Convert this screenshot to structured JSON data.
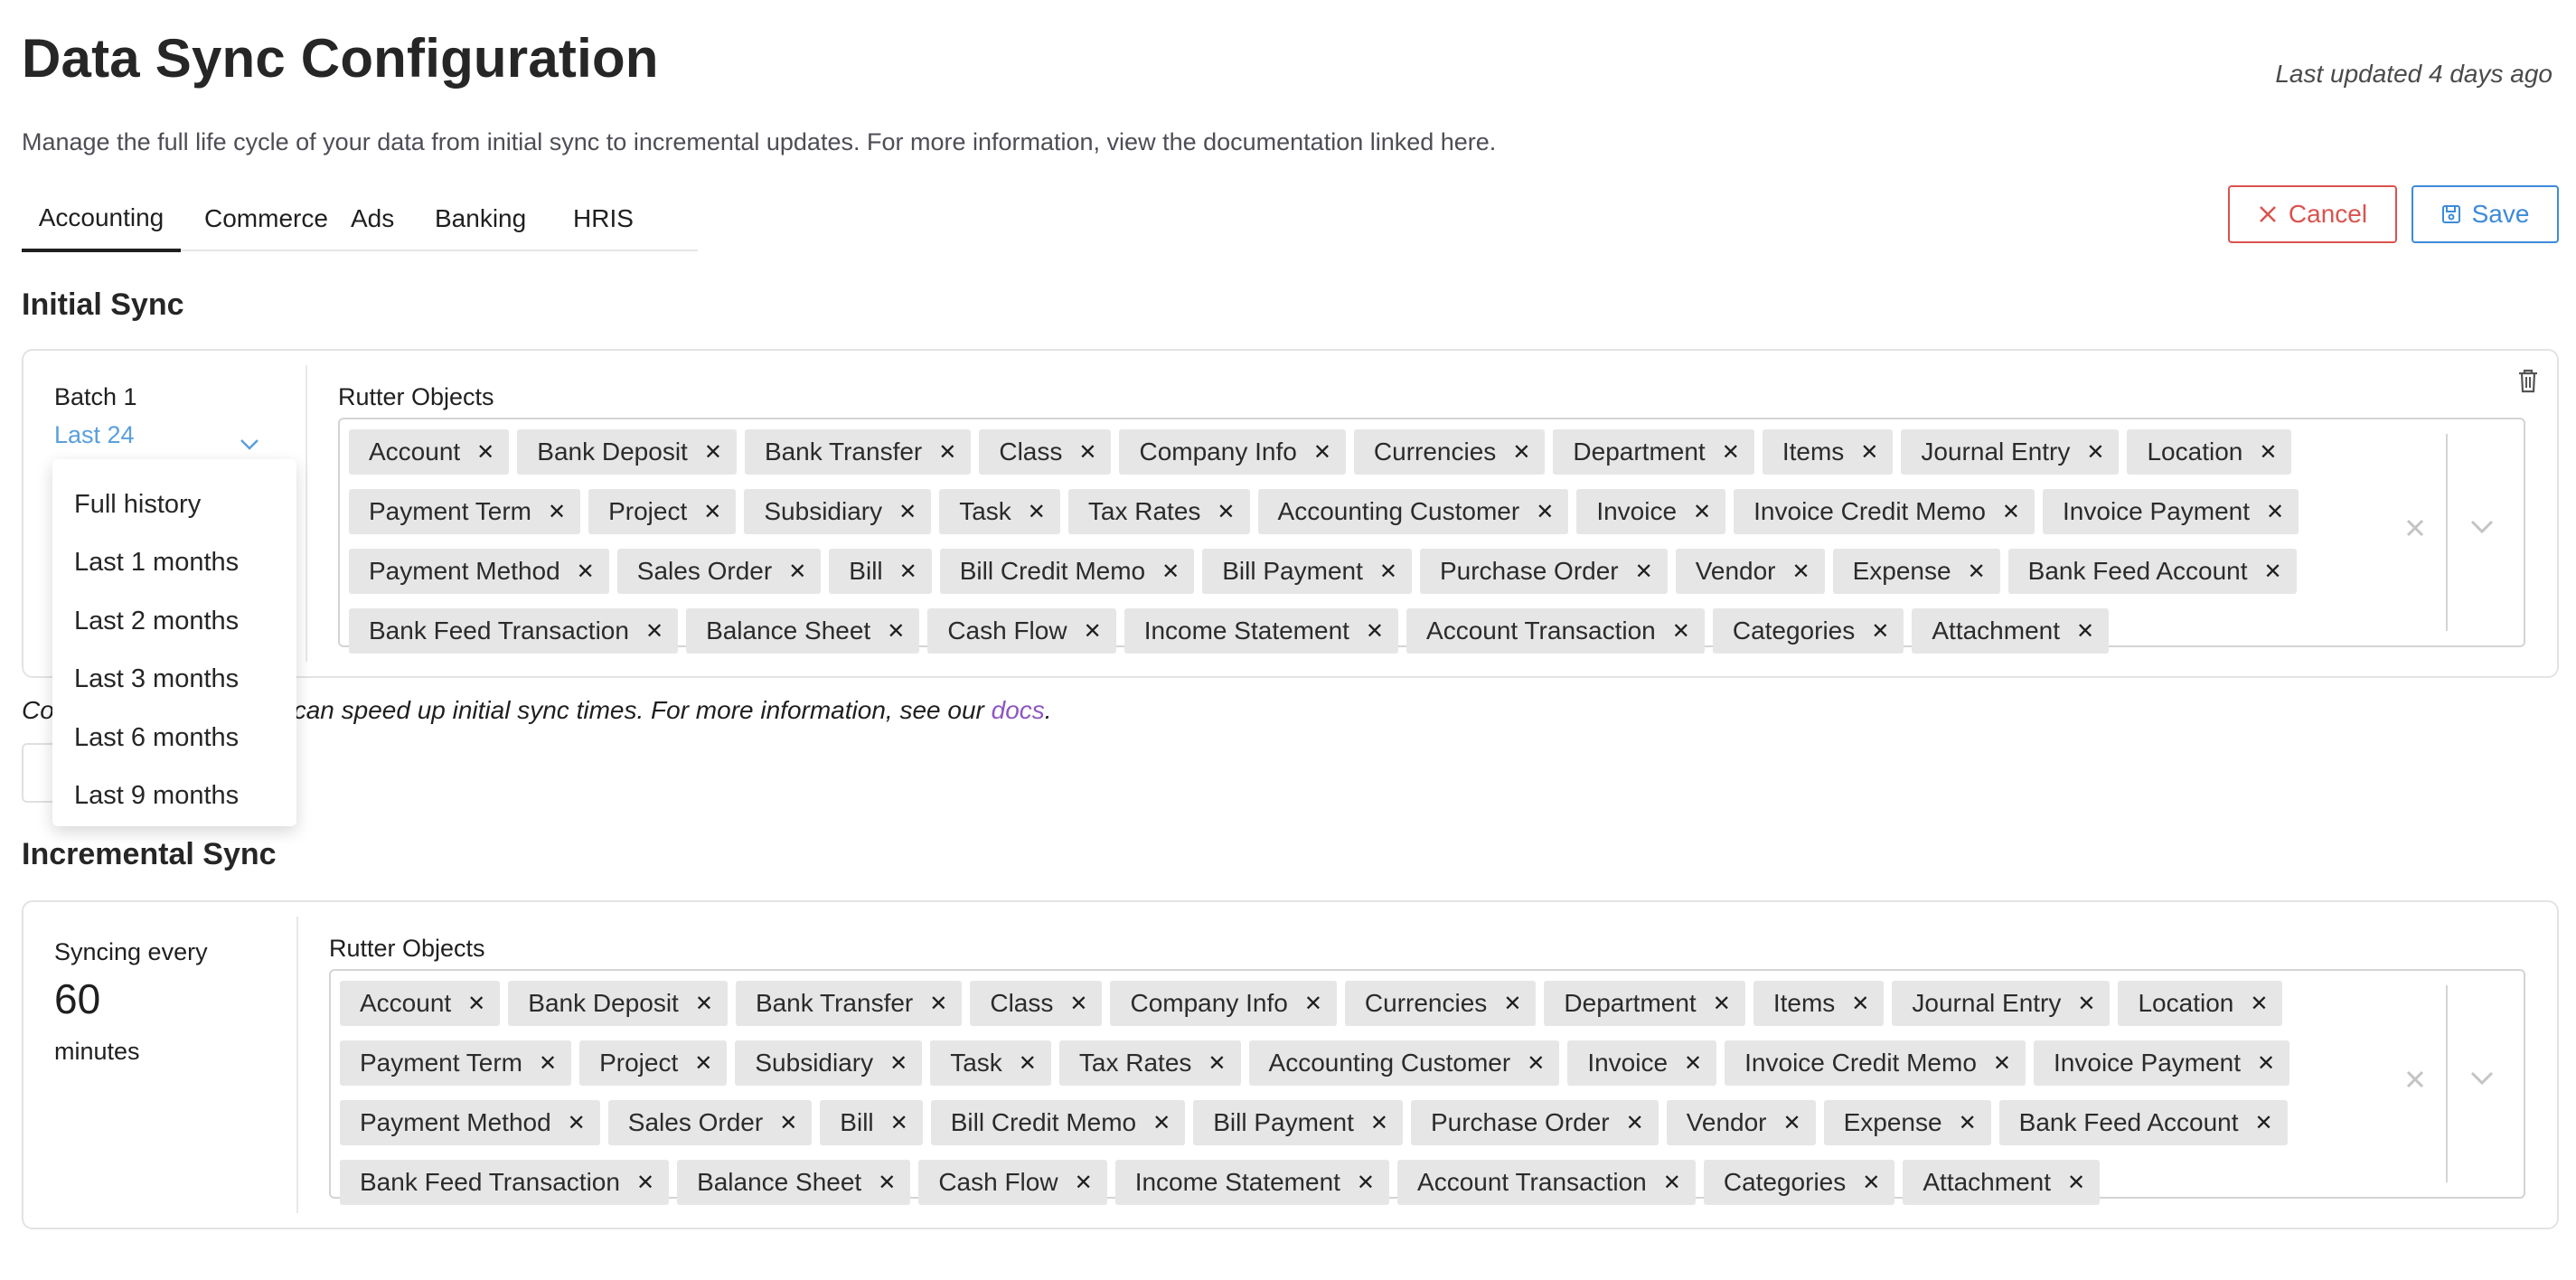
{
  "header": {
    "title": "Data Sync Configuration",
    "last_updated": "Last updated 4 days ago",
    "subtitle": "Manage the full life cycle of your data from initial sync to incremental updates. For more information, view the documentation linked here."
  },
  "tabs": [
    {
      "label": "Accounting",
      "active": true
    },
    {
      "label": "Commerce",
      "active": false
    },
    {
      "label": "Ads",
      "active": false
    },
    {
      "label": "Banking",
      "active": false
    },
    {
      "label": "HRIS",
      "active": false
    }
  ],
  "actions": {
    "cancel_label": "Cancel",
    "save_label": "Save"
  },
  "initial_sync": {
    "title": "Initial Sync",
    "batch_label": "Batch 1",
    "batch_selected": "Last 24",
    "rutter_objects_label": "Rutter Objects",
    "objects": [
      "Account",
      "Bank Deposit",
      "Bank Transfer",
      "Class",
      "Company Info",
      "Currencies",
      "Department",
      "Items",
      "Journal Entry",
      "Location",
      "Payment Term",
      "Project",
      "Subsidiary",
      "Task",
      "Tax Rates",
      "Accounting Customer",
      "Invoice",
      "Invoice Credit Memo",
      "Invoice Payment",
      "Payment Method",
      "Sales Order",
      "Bill",
      "Bill Credit Memo",
      "Bill Payment",
      "Purchase Order",
      "Vendor",
      "Expense",
      "Bank Feed Account",
      "Bank Feed Transaction",
      "Balance Sheet",
      "Cash Flow",
      "Income Statement",
      "Account Transaction",
      "Categories",
      "Attachment"
    ],
    "note_prefix": "Co",
    "note_text": "ches can speed up initial sync times. For more information, see our ",
    "note_link": "docs",
    "note_suffix": "."
  },
  "dropdown": {
    "options": [
      "Full history",
      "Last 1 months",
      "Last 2 months",
      "Last 3 months",
      "Last 6 months",
      "Last 9 months"
    ]
  },
  "incremental_sync": {
    "title": "Incremental Sync",
    "syncing_label": "Syncing every",
    "value": "60",
    "unit": "minutes",
    "rutter_objects_label": "Rutter Objects",
    "objects": [
      "Account",
      "Bank Deposit",
      "Bank Transfer",
      "Class",
      "Company Info",
      "Currencies",
      "Department",
      "Items",
      "Journal Entry",
      "Location",
      "Payment Term",
      "Project",
      "Subsidiary",
      "Task",
      "Tax Rates",
      "Accounting Customer",
      "Invoice",
      "Invoice Credit Memo",
      "Invoice Payment",
      "Payment Method",
      "Sales Order",
      "Bill",
      "Bill Credit Memo",
      "Bill Payment",
      "Purchase Order",
      "Vendor",
      "Expense",
      "Bank Feed Account",
      "Bank Feed Transaction",
      "Balance Sheet",
      "Cash Flow",
      "Income Statement",
      "Account Transaction",
      "Categories",
      "Attachment"
    ]
  },
  "colors": {
    "cancel": "#d9534f",
    "save": "#3d8bd9",
    "link": "#8e56c2",
    "select_text": "#5a9fdc"
  }
}
